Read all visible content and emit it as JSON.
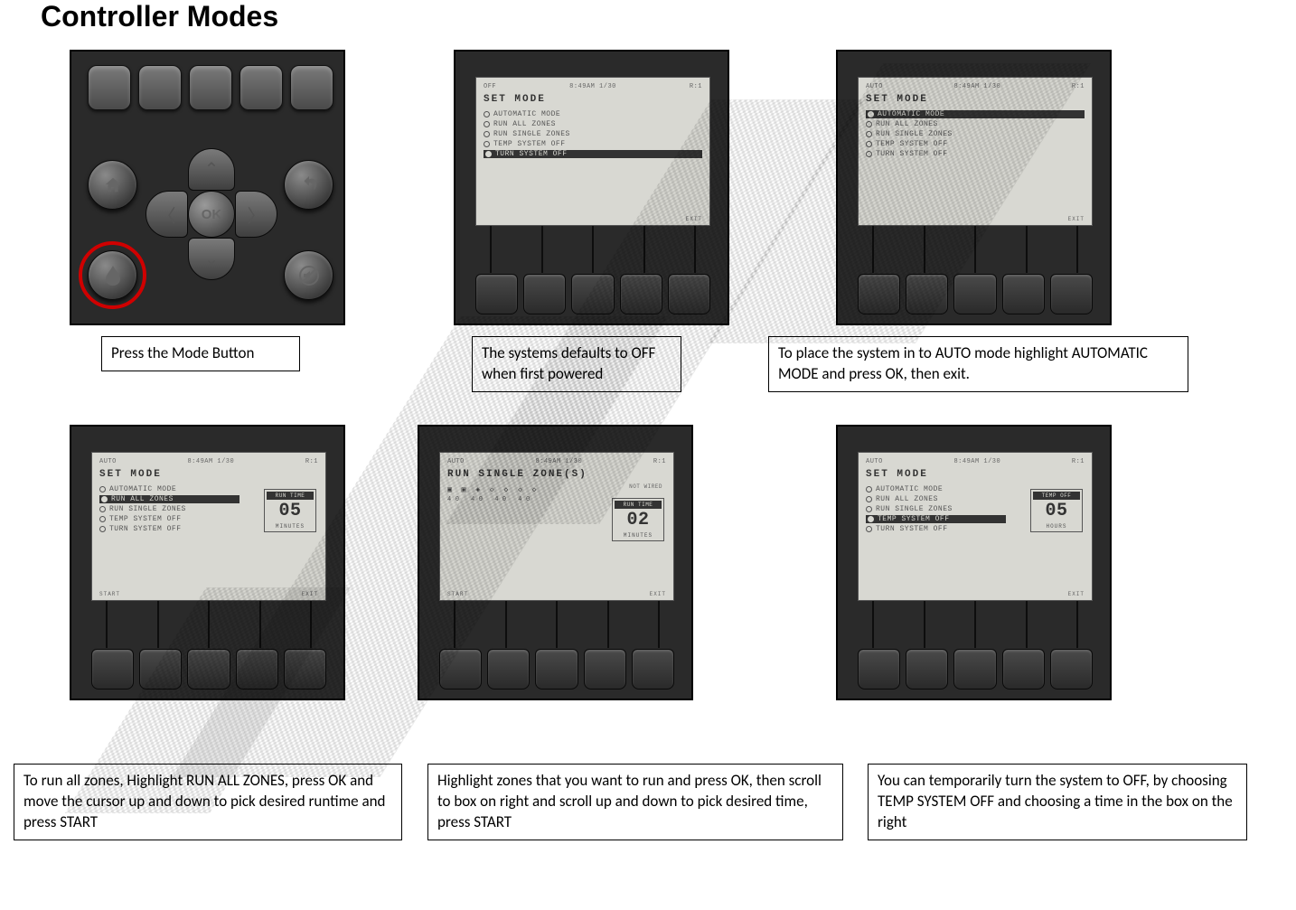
{
  "title": "Controller Modes",
  "captions": {
    "c1": "Press the Mode Button",
    "c2": "The systems defaults to OFF when first powered",
    "c3": "To place the system in to AUTO mode highlight AUTOMATIC MODE and press OK, then exit.",
    "c4": "To run all zones, Highlight RUN ALL ZONES, press OK and move the cursor up and down to pick desired runtime and press START",
    "c5": "Highlight zones that you want to run and press OK, then scroll to box on right and scroll up and down to pick desired time, press START",
    "c6": "You can temporarily turn the system to OFF, by choosing TEMP SYSTEM OFF and choosing a time in the box on the right"
  },
  "lcd_common": {
    "title": "SET MODE",
    "time": "8:49AM 1/30",
    "r1": "R:1",
    "items": [
      "AUTOMATIC MODE",
      "RUN ALL ZONES",
      "RUN SINGLE ZONES",
      "TEMP SYSTEM OFF",
      "TURN SYSTEM OFF"
    ]
  },
  "screens": {
    "s2": {
      "status": "OFF",
      "highlighted_index": 4,
      "selected_index": 4,
      "footer_left": "",
      "footer_right": "EXIT"
    },
    "s3": {
      "status": "AUTO",
      "highlighted_index": 0,
      "selected_index": 0,
      "footer_left": "",
      "footer_right": "EXIT"
    },
    "s4": {
      "status": "AUTO",
      "highlighted_index": 1,
      "selected_index": 1,
      "box": {
        "title": "RUN TIME",
        "value": "05",
        "unit": "MINUTES"
      },
      "footer_left": "START",
      "footer_right": "EXIT"
    },
    "s5": {
      "status": "AUTO",
      "title": "RUN SINGLE ZONE(S)",
      "not_wired": "NOT WIRED",
      "zone_icons": "▣ ▣ ◈ ◇ ◇ ◇ ◇",
      "zone_nums": "40 40 40 40",
      "box": {
        "title": "RUN TIME",
        "value": "02",
        "unit": "MINUTES"
      },
      "footer_left": "START",
      "footer_right": "EXIT"
    },
    "s6": {
      "status": "AUTO",
      "highlighted_index": 3,
      "selected_index": 3,
      "box": {
        "title": "TEMP OFF",
        "value": "05",
        "unit": "HOURS"
      },
      "footer_left": "",
      "footer_right": "EXIT"
    }
  },
  "ok_label": "OK"
}
